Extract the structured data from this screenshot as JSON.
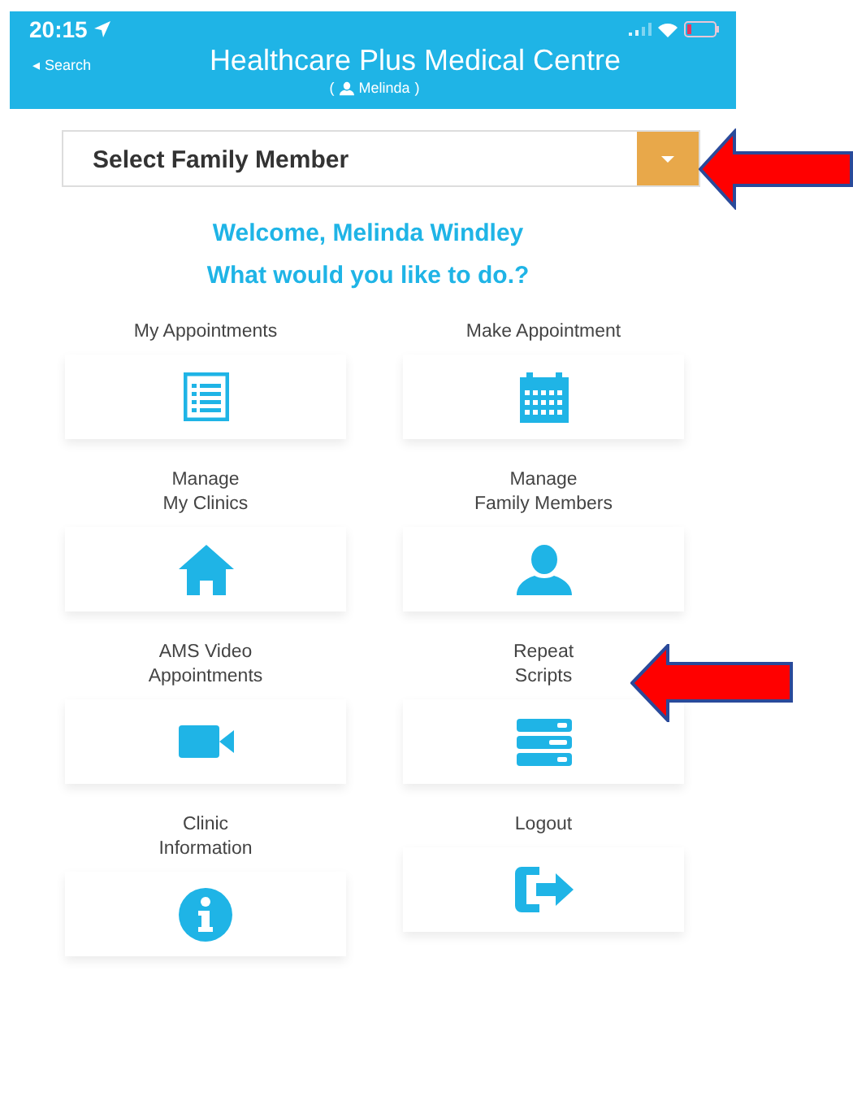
{
  "status_bar": {
    "time": "20:15",
    "back_label": "◂ Search"
  },
  "header": {
    "title": "Healthcare Plus Medical Centre",
    "user_open": "(",
    "user_name": "Melinda",
    "user_close": ")"
  },
  "family_select": {
    "value": "Select Family Member"
  },
  "welcome": "Welcome, Melinda Windley",
  "prompt": "What would you like to do.?",
  "tiles": [
    {
      "label": "My Appointments",
      "kind": "list"
    },
    {
      "label": "Make Appointment",
      "kind": "calendar"
    },
    {
      "label": "Manage\nMy Clinics",
      "kind": "home"
    },
    {
      "label": "Manage\nFamily Members",
      "kind": "person"
    },
    {
      "label": "AMS Video\nAppointments",
      "kind": "video"
    },
    {
      "label": "Repeat\nScripts",
      "kind": "server"
    },
    {
      "label": "Clinic\nInformation",
      "kind": "info"
    },
    {
      "label": "Logout",
      "kind": "logout"
    }
  ]
}
